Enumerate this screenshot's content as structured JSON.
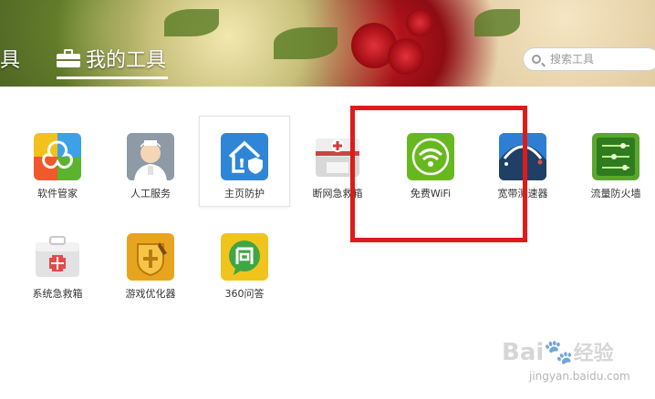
{
  "header": {
    "tab_partial": "具",
    "tab_active": "我的工具",
    "search_placeholder": "搜索工具"
  },
  "tools": [
    {
      "label": "软件管家",
      "icon": "software-manager-icon"
    },
    {
      "label": "人工服务",
      "icon": "customer-service-icon"
    },
    {
      "label": "主页防护",
      "icon": "homepage-protection-icon"
    },
    {
      "label": "断网急救箱",
      "icon": "network-first-aid-icon"
    },
    {
      "label": "免费WiFi",
      "icon": "wifi-icon"
    },
    {
      "label": "宽带测速器",
      "icon": "speedometer-icon"
    },
    {
      "label": "流量防火墙",
      "icon": "traffic-firewall-icon"
    },
    {
      "label": "系统急救箱",
      "icon": "system-first-aid-icon"
    },
    {
      "label": "游戏优化器",
      "icon": "game-optimizer-icon"
    },
    {
      "label": "360问答",
      "icon": "qa-icon"
    }
  ],
  "watermark": {
    "brand": "Bai",
    "brand_cn": "经验",
    "url": "jingyan.baidu.com"
  },
  "colors": {
    "annotation_red": "#e01a1a",
    "wifi_green": "#67b81f",
    "accent_blue": "#2f86d6"
  }
}
